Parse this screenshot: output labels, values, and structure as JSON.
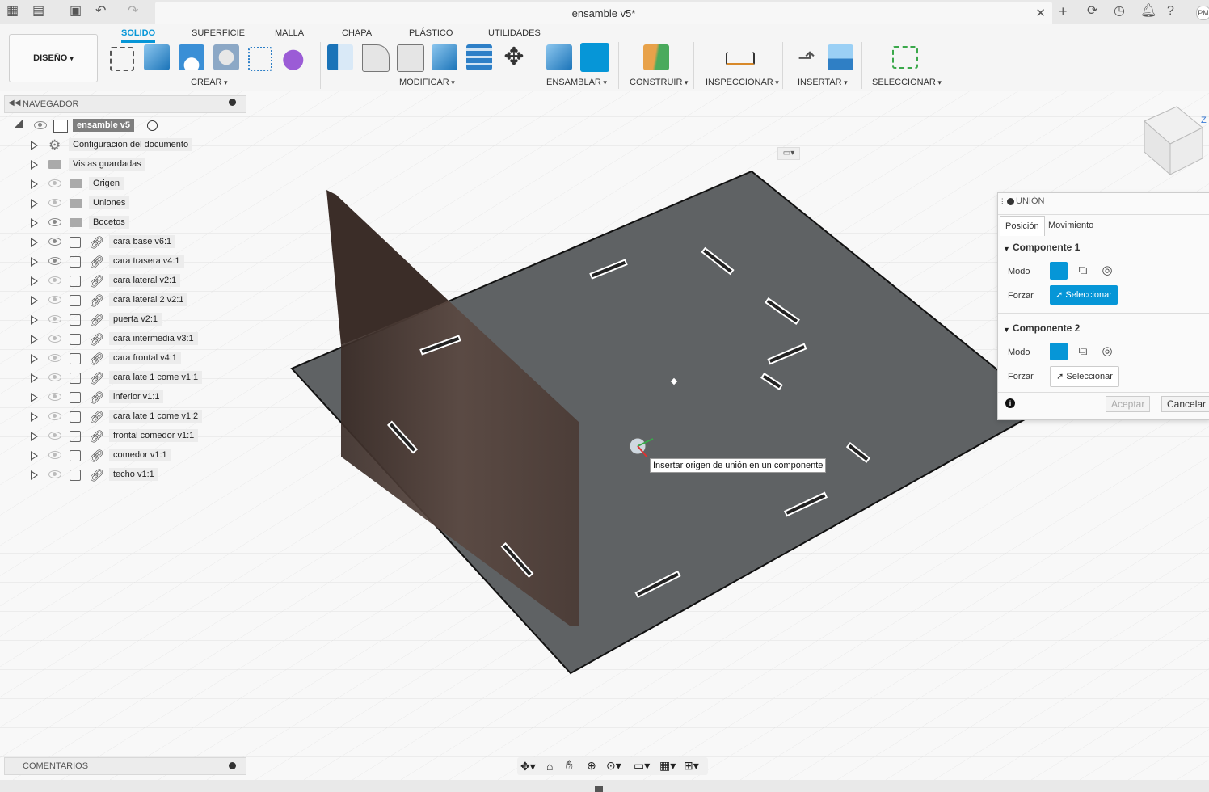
{
  "window": {
    "doc_title": "ensamble v5*",
    "user_initials": "PM"
  },
  "workspace": {
    "label": "DISEÑO"
  },
  "ribbon": {
    "tabs": [
      "SOLIDO",
      "SUPERFICIE",
      "MALLA",
      "CHAPA",
      "PLÁSTICO",
      "UTILIDADES"
    ],
    "active_tab": "SOLIDO",
    "groups": [
      "CREAR",
      "MODIFICAR",
      "ENSAMBLAR",
      "CONSTRUIR",
      "INSPECCIONAR",
      "INSERTAR",
      "SELECCIONAR"
    ]
  },
  "navigator": {
    "title": "NAVEGADOR",
    "root": "ensamble v5",
    "items": [
      {
        "label": "Configuración del documento",
        "icon": "gear-icon",
        "eye": "none"
      },
      {
        "label": "Vistas guardadas",
        "icon": "folder-icon",
        "eye": "none"
      },
      {
        "label": "Origen",
        "icon": "folder-icon",
        "eye": "hidden"
      },
      {
        "label": "Uniones",
        "icon": "folder-icon",
        "eye": "hidden"
      },
      {
        "label": "Bocetos",
        "icon": "folder-icon",
        "eye": "visible"
      },
      {
        "label": "cara base v6:1",
        "icon": "component-icon",
        "eye": "visible"
      },
      {
        "label": "cara trasera v4:1",
        "icon": "component-icon",
        "eye": "visible"
      },
      {
        "label": "cara lateral v2:1",
        "icon": "component-icon",
        "eye": "hidden"
      },
      {
        "label": "cara lateral 2 v2:1",
        "icon": "component-icon",
        "eye": "hidden"
      },
      {
        "label": "puerta v2:1",
        "icon": "component-icon",
        "eye": "hidden"
      },
      {
        "label": "cara intermedia v3:1",
        "icon": "component-icon",
        "eye": "hidden"
      },
      {
        "label": "cara frontal v4:1",
        "icon": "component-icon",
        "eye": "hidden"
      },
      {
        "label": "cara late 1 come v1:1",
        "icon": "component-icon",
        "eye": "hidden"
      },
      {
        "label": "inferior v1:1",
        "icon": "component-icon",
        "eye": "hidden"
      },
      {
        "label": "cara late 1 come v1:2",
        "icon": "component-icon",
        "eye": "hidden"
      },
      {
        "label": "frontal comedor v1:1",
        "icon": "component-icon",
        "eye": "hidden"
      },
      {
        "label": "comedor v1:1",
        "icon": "component-icon",
        "eye": "hidden"
      },
      {
        "label": "techo v1:1",
        "icon": "component-icon",
        "eye": "hidden"
      }
    ]
  },
  "comments": {
    "title": "COMENTARIOS"
  },
  "viewport": {
    "tooltip": "Insertar origen de unión en un componente"
  },
  "union_panel": {
    "title": "UNIÓN",
    "tabs": [
      "Posición",
      "Movimiento"
    ],
    "active_tab": "Posición",
    "component1": {
      "title": "Componente 1",
      "mode_label": "Modo",
      "force_label": "Forzar",
      "select_label": "Seleccionar",
      "select_active": true
    },
    "component2": {
      "title": "Componente 2",
      "mode_label": "Modo",
      "force_label": "Forzar",
      "select_label": "Seleccionar",
      "select_active": false
    },
    "ok_label": "Aceptar",
    "cancel_label": "Cancelar"
  },
  "colors": {
    "accent": "#0696d7",
    "plate": "#5f6264",
    "wood": "#4a3a34"
  }
}
